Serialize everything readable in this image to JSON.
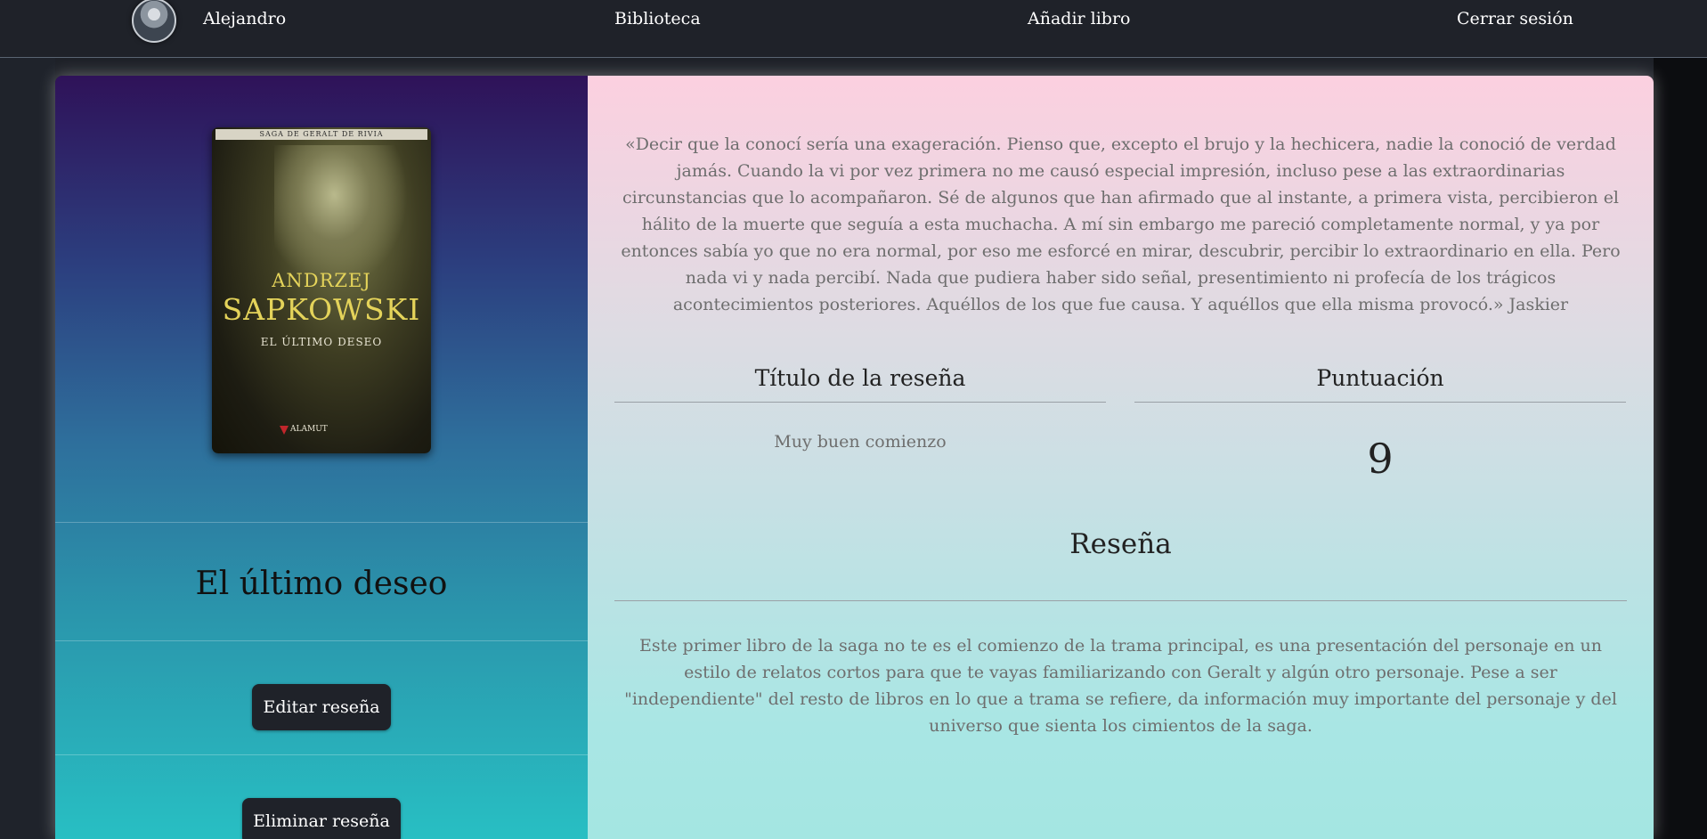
{
  "nav": {
    "username": "Alejandro",
    "library": "Biblioteca",
    "add_book": "Añadir libro",
    "logout": "Cerrar sesión"
  },
  "book": {
    "title": "El último deseo",
    "cover": {
      "series": "SAGA DE GERALT DE RIVIA",
      "author_first": "ANDRZEJ",
      "author_last": "SAPKOWSKI",
      "title": "EL ÚLTIMO DESEO",
      "publisher": "ALAMUT"
    }
  },
  "actions": {
    "edit": "Editar reseña",
    "delete": "Eliminar reseña"
  },
  "quote": "«Decir que la conocí sería una exageración. Pienso que, excepto el brujo y la hechicera, nadie la conoció de verdad jamás. Cuando la vi por vez primera no me causó especial impresión, incluso pese a las extraordinarias circunstancias que lo acompañaron. Sé de algunos que han afirmado que al instante, a primera vista, percibieron el hálito de la muerte que seguía a esta muchacha. A mí sin embargo me pareció completamente normal, y ya por entonces sabía yo que no era normal, por eso me esforcé en mirar, descubrir, percibir lo extraordinario en ella. Pero nada vi y nada percibí. Nada que pudiera haber sido señal, presentimiento ni profecía de los trágicos acontecimientos posteriores. Aquéllos de los que fue causa. Y aquéllos que ella misma provocó.» Jaskier",
  "review": {
    "title_header": "Título de la reseña",
    "score_header": "Puntuación",
    "title_value": "Muy buen comienzo",
    "score_value": "9",
    "body_header": "Reseña",
    "body": "Este primer libro de la saga no te es el comienzo de la trama principal, es una presentación del personaje en un estilo de relatos cortos para que te vayas familiarizando con Geralt y algún otro personaje. Pese a ser \"independiente\" del resto de libros en lo que a trama se refiere, da información muy importante del personaje y del universo que sienta los cimientos de la saga."
  }
}
